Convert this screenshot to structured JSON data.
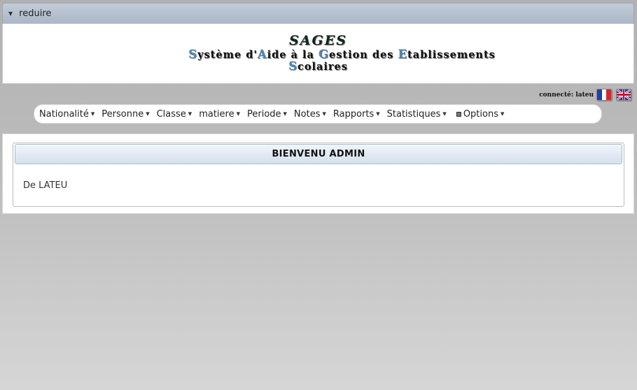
{
  "collapse": {
    "label": "reduire",
    "caret_icon": "caret-down-icon"
  },
  "banner": {
    "title": "SAGES",
    "subtitle_line1": [
      {
        "cap": "S",
        "rest": "ystème d'"
      },
      {
        "cap": "A",
        "rest": "ide à la "
      },
      {
        "cap": "G",
        "rest": "estion des "
      },
      {
        "cap": "E",
        "rest": "tablissements"
      }
    ],
    "subtitle_line2": [
      {
        "cap": "S",
        "rest": "colaires"
      }
    ],
    "cap_color": "#4a87b8"
  },
  "session": {
    "connected_label": "connecté: lateu",
    "languages": [
      {
        "code": "fr",
        "icon": "french-flag-icon"
      },
      {
        "code": "en",
        "icon": "uk-flag-icon"
      }
    ]
  },
  "menu": {
    "items": [
      {
        "label": "Nationalité"
      },
      {
        "label": "Personne"
      },
      {
        "label": "Classe"
      },
      {
        "label": "matiere"
      },
      {
        "label": "Periode"
      },
      {
        "label": "Notes"
      },
      {
        "label": "Rapports"
      },
      {
        "label": "Statistiques"
      },
      {
        "label": "Options",
        "icon": "options-icon"
      }
    ]
  },
  "welcome": {
    "heading": "BIENVENU ADMIN",
    "message": "De LATEU"
  },
  "colors": {
    "header_bar": "#b4c0cf",
    "panel_header": "#dde7f1",
    "page_background": "#bdbdbd"
  }
}
